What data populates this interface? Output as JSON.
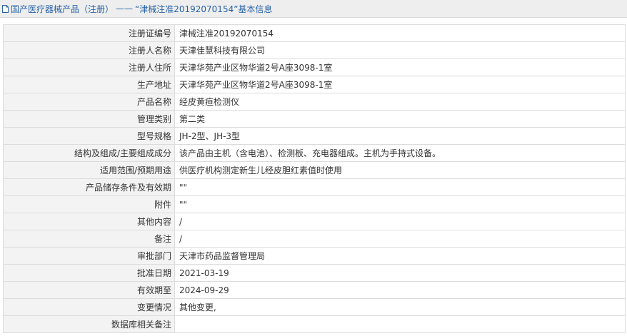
{
  "breadcrumb": {
    "root": "国产医疗器械产品（注册）",
    "separator": "——",
    "current": "“津械注准20192070154”基本信息"
  },
  "rows": [
    {
      "label": "注册证编号",
      "value": "津械注准20192070154"
    },
    {
      "label": "注册人名称",
      "value": "天津佳慧科技有限公司"
    },
    {
      "label": "注册人住所",
      "value": "天津华苑产业区物华道2号A座3098-1室"
    },
    {
      "label": "生产地址",
      "value": "天津华苑产业区物华道2号A座3098-1室"
    },
    {
      "label": "产品名称",
      "value": "经皮黄疸检测仪"
    },
    {
      "label": "管理类别",
      "value": "第二类"
    },
    {
      "label": "型号规格",
      "value": "JH-2型、JH-3型"
    },
    {
      "label": "结构及组成/主要组成成分",
      "value": "该产品由主机（含电池）、检测板、充电器组成。主机为手持式设备。"
    },
    {
      "label": "适用范围/预期用途",
      "value": "供医疗机构测定新生儿经皮胆红素值时使用"
    },
    {
      "label": "产品储存条件及有效期",
      "value": "\"\""
    },
    {
      "label": "附件",
      "value": "\"\""
    },
    {
      "label": "其他内容",
      "value": "/"
    },
    {
      "label": "备注",
      "value": "/"
    },
    {
      "label": "审批部门",
      "value": "天津市药品监督管理局"
    },
    {
      "label": "批准日期",
      "value": "2021-03-19"
    },
    {
      "label": "有效期至",
      "value": "2024-09-29"
    },
    {
      "label": "变更情况",
      "value": "其他变更,"
    },
    {
      "label": "数据库相关备注",
      "value": ""
    }
  ],
  "icons": {
    "breadcrumb_icon": "document-icon"
  },
  "colors": {
    "link": "#2763a8",
    "label_bg": "#f3f3f3",
    "border": "#dcdcdc",
    "titlebar_bg": "#eeeeee"
  }
}
